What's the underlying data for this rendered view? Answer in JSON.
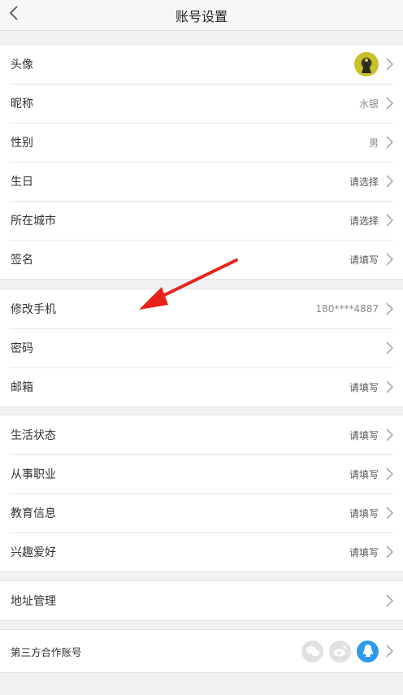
{
  "header": {
    "title": "账号设置"
  },
  "groups": [
    {
      "rows": [
        {
          "label": "头像",
          "kind": "avatar"
        },
        {
          "label": "昵称",
          "value": "水银"
        },
        {
          "label": "性别",
          "value": "男"
        },
        {
          "label": "生日",
          "value": "请选择"
        },
        {
          "label": "所在城市",
          "value": "请选择"
        },
        {
          "label": "签名",
          "value": "请填写"
        }
      ]
    },
    {
      "rows": [
        {
          "label": "修改手机",
          "value": "180****4887"
        },
        {
          "label": "密码",
          "value": ""
        },
        {
          "label": "邮箱",
          "value": "请填写"
        }
      ]
    },
    {
      "rows": [
        {
          "label": "生活状态",
          "value": "请填写"
        },
        {
          "label": "从事职业",
          "value": "请填写"
        },
        {
          "label": "教育信息",
          "value": "请填写"
        },
        {
          "label": "兴趣爱好",
          "value": "请填写"
        }
      ]
    },
    {
      "rows": [
        {
          "label": "地址管理",
          "value": ""
        }
      ]
    },
    {
      "rows": [
        {
          "label": "第三方合作账号",
          "icons": [
            "wechat-icon",
            "weibo-icon",
            "qq-icon"
          ]
        }
      ]
    }
  ],
  "colors": {
    "annotation_arrow": "#e8231b",
    "qq_blue": "#2d9be9"
  }
}
